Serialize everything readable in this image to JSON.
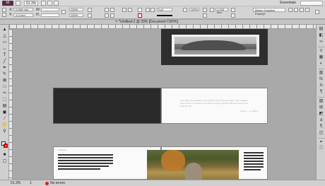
{
  "app": {
    "logo": "Id",
    "zoom": "51.3%",
    "workspace": "Essentials"
  },
  "control": {
    "x_label": "X:",
    "y_label": "Y:",
    "w_label": "W:",
    "h_label": "H:",
    "x_value": "-5.906 mm",
    "y_value": "-4.4 mm",
    "w_value": "",
    "h_value": "",
    "scale_x": "100%",
    "scale_y": "100%",
    "stroke_weight": "0 pt",
    "opacity": "100%",
    "dimension_field": "4.233 mm",
    "object_style": "[Basic Graphics Frame]+"
  },
  "document": {
    "title": "*Untitled-2 @ 33% [Document CMYK]",
    "close_glyph": "×"
  },
  "spreads": {
    "caption1": "",
    "quote": "The most sure wisdom of the world is full of lines and light. The smallest man is lost in his reach. Let each one enjoy what he has and move on to what he can.",
    "quote_attr": "Xenon — A. Writer",
    "spread3_heading": "Contents"
  },
  "status": {
    "zoom": "51.3%",
    "page": "1",
    "errors": "No errors"
  },
  "colors": {
    "accent_error": "#d62020",
    "pasteboard": "#a9a9a9"
  },
  "icons": [
    "selection-tool-icon",
    "direct-selection-tool-icon",
    "page-tool-icon",
    "gap-tool-icon",
    "type-tool-icon",
    "line-tool-icon",
    "pen-tool-icon",
    "pencil-tool-icon",
    "rectangle-frame-tool-icon",
    "rectangle-tool-icon",
    "scissors-tool-icon",
    "free-transform-tool-icon",
    "gradient-tool-icon",
    "note-tool-icon",
    "eyedropper-tool-icon",
    "hand-tool-icon",
    "zoom-tool-icon"
  ]
}
